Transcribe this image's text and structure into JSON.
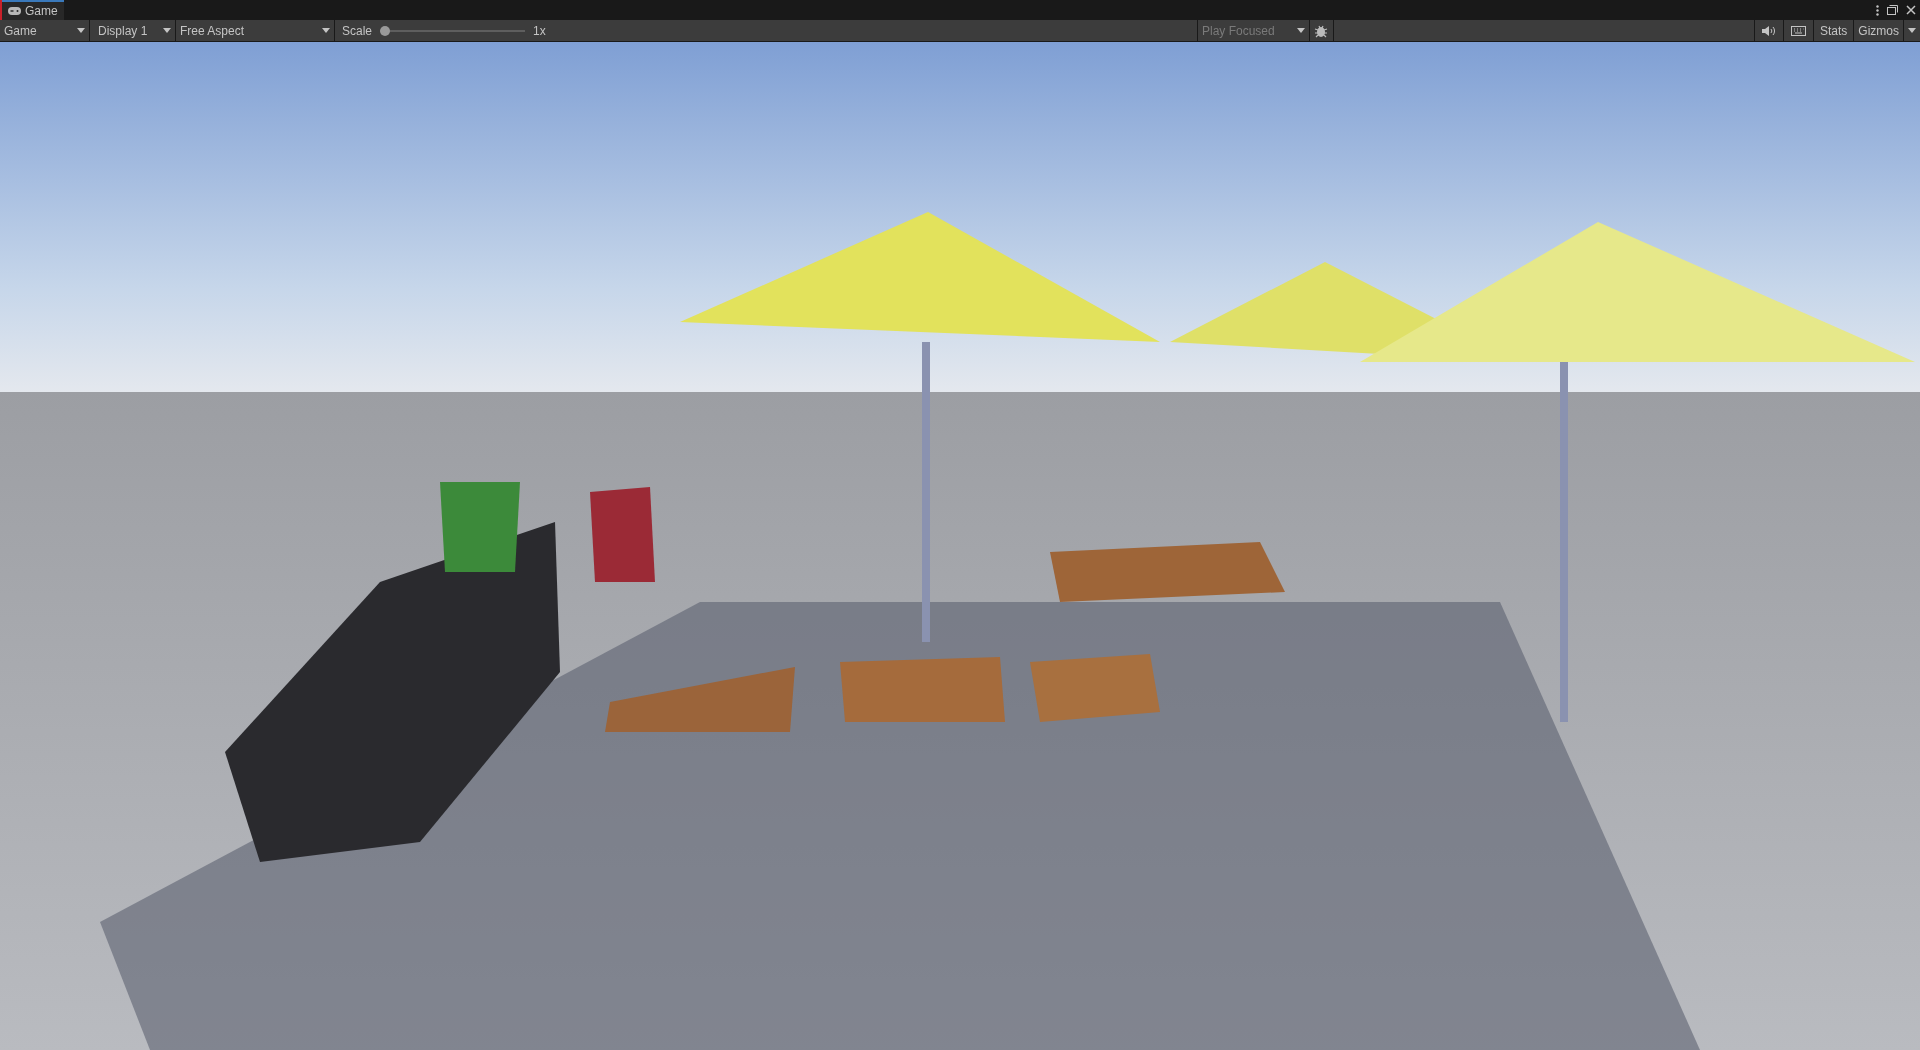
{
  "tab": {
    "label": "Game",
    "selected": true
  },
  "toolbar": {
    "view_dropdown": "Game",
    "display_dropdown": "Display 1",
    "aspect_dropdown": "Free Aspect",
    "scale": {
      "label": "Scale",
      "level": 0,
      "reading": "1x"
    },
    "play_mode_dropdown": {
      "label": "Play Focused",
      "disabled": true
    },
    "stats_button": "Stats",
    "gizmos_button": "Gizmos"
  }
}
